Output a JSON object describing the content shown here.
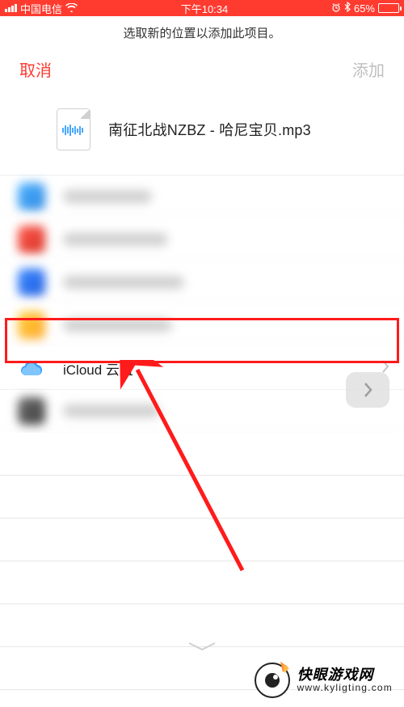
{
  "status_bar": {
    "carrier": "中国电信",
    "time": "下午10:34",
    "battery_pct": "65%"
  },
  "prompt": "选取新的位置以添加此项目。",
  "nav": {
    "cancel": "取消",
    "add": "添加"
  },
  "file": {
    "name": "南征北战NZBZ - 哈尼宝贝.mp3"
  },
  "rows": {
    "icloud_label": "iCloud 云盘"
  },
  "watermark": {
    "title": "快眼游戏网",
    "url": "www.kyligting.com"
  }
}
